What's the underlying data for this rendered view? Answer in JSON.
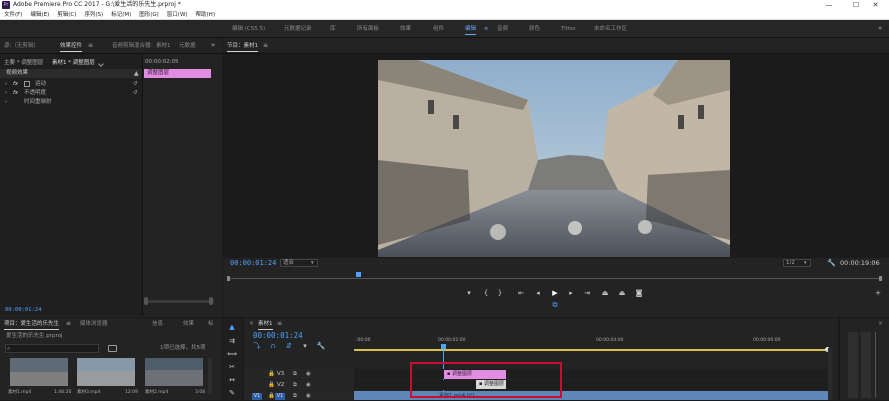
{
  "titlebar": {
    "title": "Adobe Premiere Pro CC 2017 - G:\\爱生活的乐先生.prproj *",
    "app_icon": "Pr",
    "minimize": "—",
    "maximize": "☐",
    "close": "✕"
  },
  "menu": [
    "文件(F)",
    "编辑(E)",
    "剪辑(C)",
    "序列(S)",
    "标记(M)",
    "图形(G)",
    "窗口(W)",
    "帮助(H)"
  ],
  "workspaces": [
    {
      "label": "编辑 (CS5.5)",
      "active": false
    },
    {
      "label": "元数据记录",
      "active": false
    },
    {
      "label": "库",
      "active": false
    },
    {
      "label": "所有面板",
      "active": false
    },
    {
      "label": "效果",
      "active": false
    },
    {
      "label": "组件",
      "active": false
    },
    {
      "label": "编辑",
      "active": true
    },
    {
      "label": "音频",
      "active": false
    },
    {
      "label": "颜色",
      "active": false
    },
    {
      "label": "Titles",
      "active": false
    },
    {
      "label": "未命名工作区",
      "active": false
    }
  ],
  "effect_controls": {
    "tabs": [
      "源:（无剪辑）",
      "效果控件",
      "音频剪辑混合器：素材1",
      "元数据"
    ],
    "breadcrumb": "主要 * 调整图层",
    "breadcrumb_sel": "素材1 * 调整图层",
    "section": "视频效果",
    "items": [
      "运动",
      "不透明度",
      "时间重映射"
    ],
    "mini_tc": "00:00:02:05",
    "clip_bar": "调整图层",
    "bottom_tc": "00:00:01:24"
  },
  "program": {
    "tab": "节目：素材1",
    "timecode": "00:00:01:24",
    "fit": "适合",
    "resolution": "1/2",
    "duration": "00:00:19:06"
  },
  "project": {
    "tabs": [
      "项目：爱生活的乐先生",
      "媒体浏览器",
      "信息",
      "效果",
      "标"
    ],
    "file": "爱生活的乐先生.prproj",
    "count": "1项已选择，共5项",
    "search_placeholder": "",
    "clips": [
      {
        "name": "素材1.mp4",
        "dur": "1:46:20"
      },
      {
        "name": "素材3.mp4",
        "dur": "12:09"
      },
      {
        "name": "素材2.mp4",
        "dur": "3:08"
      }
    ]
  },
  "timeline": {
    "tab": "素材1",
    "timecode": "00:00:01:24",
    "ruler": [
      ":00:00",
      "00:00:02:00",
      "00:00:04:00",
      "00:00:06:00"
    ],
    "tracks": [
      "V3",
      "V2",
      "V1"
    ],
    "track_src": "V1",
    "clip_top": "调整图层",
    "clip_mid": "调整图层",
    "clip_bottom": "素材1.mp4 [V]"
  },
  "colors": {
    "accent": "#4da3ff",
    "pink": "#e38ce4",
    "highlight_box": "#c8102e"
  }
}
